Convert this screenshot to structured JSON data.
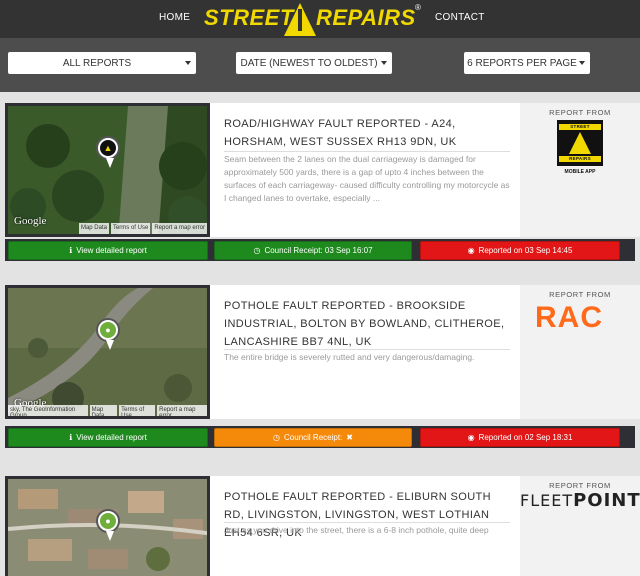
{
  "nav": {
    "home": "HOME",
    "contact": "CONTACT",
    "logo_left": "STREET",
    "logo_right": "REPAIRS",
    "logo_mark": "®"
  },
  "filters": {
    "type": "ALL REPORTS",
    "sort": "DATE (NEWEST TO OLDEST)",
    "per_page": "6 REPORTS PER PAGE"
  },
  "map_labels": {
    "google": "Google",
    "map_data": "Map Data",
    "terms": "Terms of Use",
    "error": "Report a map error",
    "geo_credit": "sky, The GeoInformation Group"
  },
  "reports": [
    {
      "title": "ROAD/HIGHWAY FAULT REPORTED - A24, HORSHAM, WEST SUSSEX RH13 9DN, UK",
      "description": "Seam between the 2 lanes on the dual carriageway is damaged for approximately 500 yards, there is a gap of upto 4 inches between the surfaces of each carriageway- caused difficulty controlling my motorcycle as I changed lanes to overtake, especially ...",
      "source_label": "REPORT FROM",
      "view_label": "View detailed report",
      "council_label": "Council Receipt: 03 Sep 16:07",
      "council_color": "#1e8a1e",
      "reported_label": "Reported on 03 Sep 14:45",
      "source_logo": {
        "top": "STREET",
        "bottom": "REPAIRS",
        "sub": "MOBILE APP"
      }
    },
    {
      "title": "POTHOLE FAULT REPORTED - BROOKSIDE INDUSTRIAL, BOLTON BY BOWLAND, CLITHEROE, LANCASHIRE BB7 4NL, UK",
      "description": "The entire bridge is severely rutted and very dangerous/damaging.",
      "source_label": "REPORT FROM",
      "view_label": "View detailed report",
      "council_label": "Council Receipt:",
      "council_color": "#f58a0a",
      "reported_label": "Reported on 02 Sep 18:31",
      "source_logo": {
        "text": "RAC"
      }
    },
    {
      "title": "POTHOLE FAULT REPORTED - ELIBURN SOUTH RD, LIVINGSTON, LIVINGSTON, WEST LOTHIAN EH54 6SR, UK",
      "description": "Just as you drive into the street, there is a 6-8 inch pothole, quite deep",
      "source_label": "REPORT FROM",
      "source_logo": {
        "light": "FLEET",
        "bold": "POINT"
      }
    }
  ],
  "colors": {
    "header_bg": "#333333",
    "filter_bg": "#4d4d4d",
    "logo_yellow": "#f1d900",
    "view_green": "#1e8a1e",
    "reported_red": "#e21616",
    "rac_orange": "#ff6a1a"
  }
}
